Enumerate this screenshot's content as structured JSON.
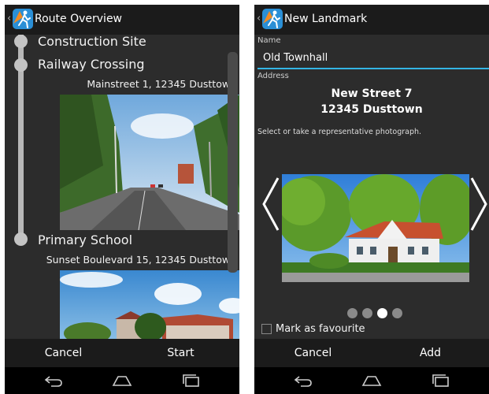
{
  "left_screen": {
    "title": "Route Overview",
    "stops": [
      {
        "name": "Construction Site"
      },
      {
        "name": "Railway Crossing",
        "address": "Mainstreet 1, 12345 Dusttown"
      },
      {
        "name": "Primary School",
        "address": "Sunset Boulevard 15, 12345 Dusttown"
      }
    ],
    "cancel_label": "Cancel",
    "start_label": "Start"
  },
  "right_screen": {
    "title": "New Landmark",
    "name_label": "Name",
    "name_value": "Old Townhall",
    "address_label": "Address",
    "address_line1": "New Street 7",
    "address_line2": "12345 Dusttown",
    "photo_hint": "Select or take a representative photograph.",
    "pager": {
      "count": 4,
      "active_index": 2
    },
    "favourite_label": "Mark as favourite",
    "favourite_checked": false,
    "cancel_label": "Cancel",
    "add_label": "Add"
  },
  "colors": {
    "accent": "#33b5e5",
    "background": "#2c2c2c",
    "bar": "#1b1b1b"
  },
  "icons": [
    "back-chevron-icon",
    "app-logo-icon",
    "back-icon",
    "home-icon",
    "recent-apps-icon",
    "previous-arrow-icon",
    "next-arrow-icon"
  ]
}
